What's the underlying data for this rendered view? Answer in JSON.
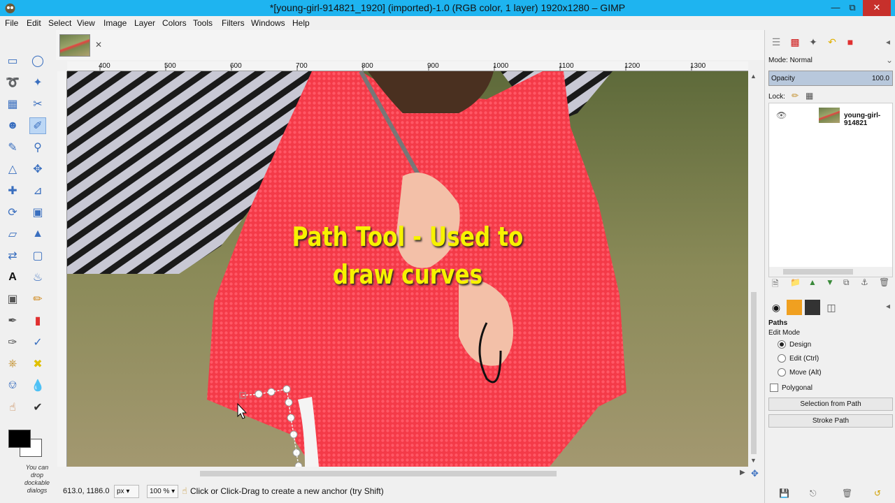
{
  "window": {
    "title": "*[young-girl-914821_1920] (imported)-1.0 (RGB color, 1 layer) 1920x1280 – GIMP"
  },
  "menu": [
    "File",
    "Edit",
    "Select",
    "View",
    "Image",
    "Layer",
    "Colors",
    "Tools",
    "Filters",
    "Windows",
    "Help"
  ],
  "ruler": {
    "h_labels": [
      "400",
      "500",
      "600",
      "700",
      "800",
      "900",
      "1000",
      "1100",
      "1200",
      "1300"
    ]
  },
  "overlay": {
    "line1": "Path Tool - Used to",
    "line2": "draw curves"
  },
  "toolbox": {
    "drop_note": "You can drop dockable dialogs"
  },
  "status": {
    "coords": "613.0, 1186.0",
    "unit": "px",
    "zoom": "100 %",
    "message": "Click or Click-Drag to create a new anchor (try Shift)"
  },
  "layers": {
    "mode_label": "Mode:",
    "mode_value": "Normal",
    "opacity_label": "Opacity",
    "opacity_value": "100.0",
    "lock_label": "Lock:",
    "layer_name": "young-girl-914821"
  },
  "paths_options": {
    "title": "Paths",
    "edit_mode_label": "Edit Mode",
    "modes": [
      "Design",
      "Edit (Ctrl)",
      "Move (Alt)"
    ],
    "selected_mode": "Design",
    "polygonal_label": "Polygonal",
    "selection_button": "Selection from Path",
    "stroke_button": "Stroke Path"
  },
  "colors": {
    "accent": "#1eb4f0",
    "overlay_text": "#f7f200",
    "close": "#c7302b"
  }
}
